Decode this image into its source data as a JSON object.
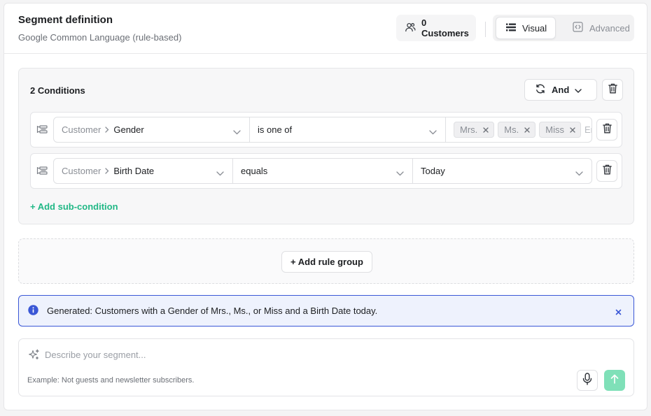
{
  "header": {
    "title": "Segment definition",
    "subtitle": "Google Common Language (rule-based)",
    "customer_count": "0 Customers",
    "mode_visual": "Visual",
    "mode_advanced": "Advanced",
    "active_mode": "Visual"
  },
  "group": {
    "title": "2 Conditions",
    "operator": "And",
    "add_sub_label": "+ Add sub-condition",
    "conditions": [
      {
        "entity": "Customer",
        "attribute": "Gender",
        "operator": "is one of",
        "values": [
          "Mrs.",
          "Ms.",
          "Miss"
        ],
        "overflow_text": "En"
      },
      {
        "entity": "Customer",
        "attribute": "Birth Date",
        "operator": "equals",
        "value": "Today"
      }
    ]
  },
  "add_rule_group_label": "+ Add rule group",
  "info": {
    "message": "Generated: Customers with a Gender of Mrs., Ms., or Miss and a Birth Date today."
  },
  "prompt": {
    "placeholder": "Describe your segment...",
    "example": "Example: Not guests and newsletter subscribers."
  },
  "icons": {
    "customers": "users-icon",
    "visual": "list-view-icon",
    "advanced": "code-icon",
    "operator": "refresh-icon",
    "delete": "trash-icon",
    "drag": "drag-handle-icon",
    "info": "info-icon",
    "spark": "sparkle-icon",
    "mic": "microphone-icon",
    "send": "arrow-up-icon"
  },
  "colors": {
    "accent_green": "#21b886",
    "send_green": "#7fe0b8",
    "info_border": "#3a57d6",
    "info_bg": "#eef2fd"
  }
}
